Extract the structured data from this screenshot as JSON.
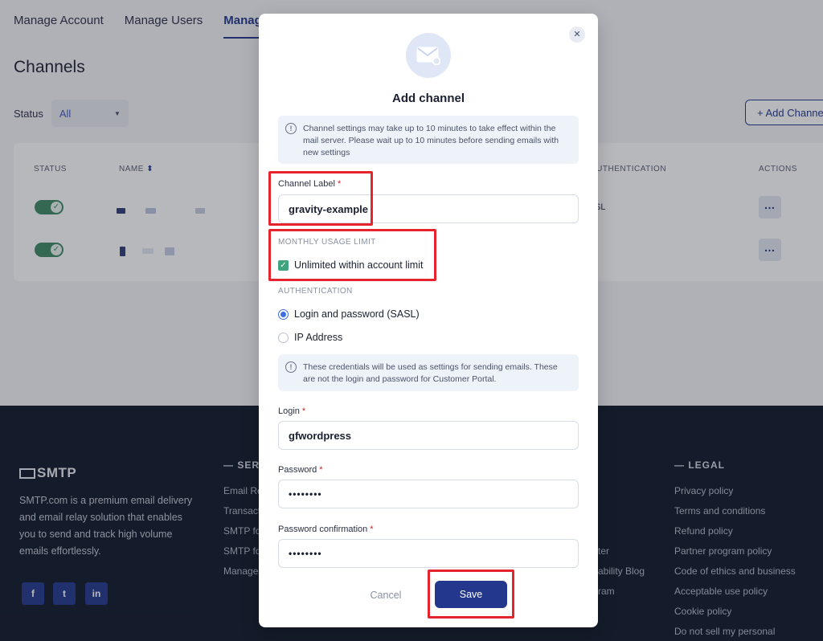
{
  "nav": {
    "tabs": [
      "Manage Account",
      "Manage Users",
      "Manage C"
    ]
  },
  "page": {
    "title": "Channels",
    "status_label": "Status",
    "status_value": "All",
    "add_channel_label": "+ Add Channel"
  },
  "table": {
    "headers": {
      "status": "STATUS",
      "name": "NAME",
      "authentication": "AUTHENTICATION",
      "actions": "ACTIONS"
    },
    "rows": [
      {
        "auth": "SL"
      },
      {
        "auth": ""
      }
    ]
  },
  "footer": {
    "logo_text": "SMTP",
    "description": "SMTP.com is a premium email delivery and email relay solution that enables you to send and track high volume emails effortlessly.",
    "services_heading": "— SERV",
    "services_links": [
      "Email Re",
      "Transact",
      "SMTP fo",
      "SMTP fo",
      "Managed"
    ],
    "middle_links": [
      "ter",
      "ability Blog",
      "ram"
    ],
    "legal_heading": "— LEGAL",
    "legal_links": [
      "Privacy policy",
      "Terms and conditions",
      "Refund policy",
      "Partner program policy",
      "Code of ethics and business",
      "Acceptable use policy",
      "Cookie policy",
      "Do not sell my personal"
    ]
  },
  "modal": {
    "title": "Add channel",
    "info_text": "Channel settings may take up to 10 minutes to take effect within the mail server. Please wait up to 10 minutes before sending emails with new settings",
    "channel_label": {
      "label": "Channel Label",
      "required_mark": "*",
      "value": "gravity-example"
    },
    "monthly_usage": {
      "section_label": "MONTHLY USAGE LIMIT",
      "checkbox_label": "Unlimited within account limit",
      "checked": true
    },
    "authentication": {
      "section_label": "AUTHENTICATION",
      "options": [
        "Login and password (SASL)",
        "IP Address"
      ],
      "selected": "Login and password (SASL)"
    },
    "credentials_info": "These credentials will be used as settings for sending emails. These are not the login and password for Customer Portal.",
    "login": {
      "label": "Login",
      "required_mark": "*",
      "value": "gfwordpress"
    },
    "password": {
      "label": "Password",
      "required_mark": "*",
      "value": "••••••••"
    },
    "password_confirmation": {
      "label": "Password confirmation",
      "required_mark": "*",
      "value": "••••••••"
    },
    "cancel_label": "Cancel",
    "save_label": "Save"
  },
  "colors": {
    "primary": "#23388c",
    "toggle_on": "#3e8a65",
    "checkbox": "#3fa57f",
    "highlight": "#e5242e",
    "footer_bg": "#101829"
  }
}
